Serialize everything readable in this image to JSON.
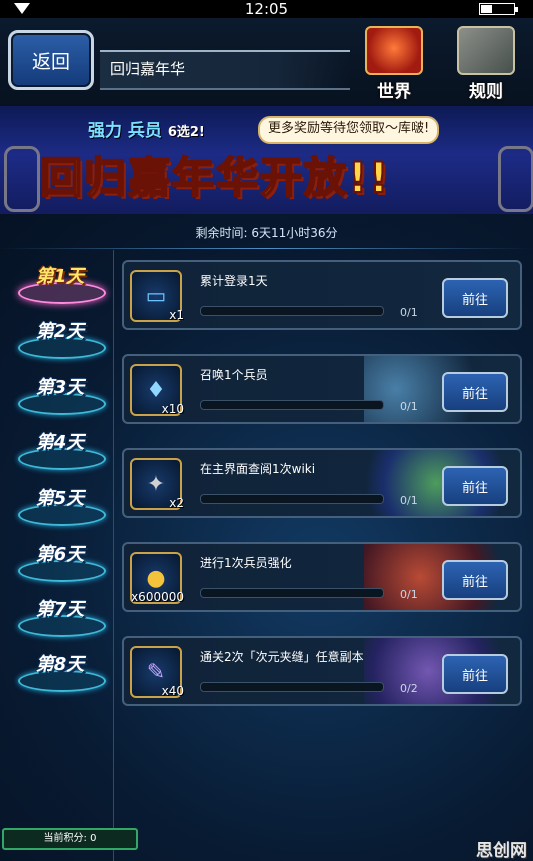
{
  "status_bar": {
    "time": "12:05",
    "battery_percent": ""
  },
  "header": {
    "back_label": "返回",
    "title": "回归嘉年华",
    "world_label": "世界",
    "rules_label": "规则"
  },
  "banner": {
    "subtitle_a": "强力",
    "subtitle_b": "兵员",
    "subtitle_c": "6选2!",
    "callout": "更多奖励等待您领取～库啵!",
    "headline": "回归嘉年华开放!!"
  },
  "timer": "剩余时间: 6天11小时36分",
  "days": [
    {
      "label": "第1天",
      "active": true
    },
    {
      "label": "第2天",
      "active": false
    },
    {
      "label": "第3天",
      "active": false
    },
    {
      "label": "第4天",
      "active": false
    },
    {
      "label": "第5天",
      "active": false
    },
    {
      "label": "第6天",
      "active": false
    },
    {
      "label": "第7天",
      "active": false
    },
    {
      "label": "第8天",
      "active": false
    }
  ],
  "tasks": [
    {
      "name": "累计登录1天",
      "qty": "x1",
      "progress": "0/1",
      "progress_fraction": 0,
      "button": "前往",
      "icon": "ticket-icon"
    },
    {
      "name": "召唤1个兵员",
      "qty": "x10",
      "progress": "0/1",
      "progress_fraction": 0,
      "button": "前往",
      "icon": "crystal-icon"
    },
    {
      "name": "在主界面查阅1次wiki",
      "qty": "x2",
      "progress": "0/1",
      "progress_fraction": 0,
      "button": "前往",
      "icon": "sword-icon"
    },
    {
      "name": "进行1次兵员强化",
      "qty": "x600000",
      "progress": "0/1",
      "progress_fraction": 0,
      "button": "前往",
      "icon": "gil-coin-icon"
    },
    {
      "name": "通关2次「次元夹缝」任意副本",
      "qty": "x40",
      "progress": "0/2",
      "progress_fraction": 0,
      "button": "前往",
      "icon": "quill-icon"
    }
  ],
  "score_label": "当前积分: 0",
  "watermark": "思创网",
  "colors": {
    "accent": "#2d63b3",
    "active_day": "#ffe66a"
  }
}
